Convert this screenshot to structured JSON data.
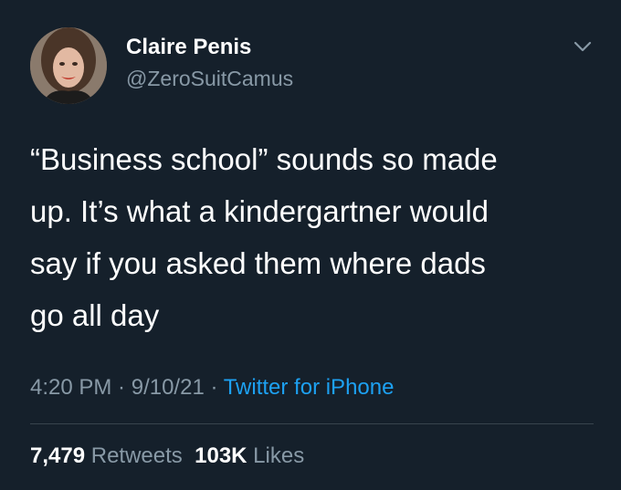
{
  "author": {
    "name": "Claire Penis",
    "handle": "@ZeroSuitCamus"
  },
  "tweet": {
    "lines": [
      "“Business school” sounds so made",
      "up. It’s what a kindergartner would",
      "say if you asked them where dads",
      "go all day"
    ],
    "time": "4:20 PM",
    "date": "9/10/21",
    "separator": " · ",
    "source": "Twitter for iPhone"
  },
  "stats": {
    "retweets_count": "7,479",
    "retweets_label": "Retweets",
    "likes_count": "103K",
    "likes_label": "Likes"
  },
  "icons": {
    "menu": "chevron-down-icon",
    "avatar": "avatar"
  },
  "colors": {
    "background": "#15202b",
    "text": "#ffffff",
    "secondary": "#8899a6",
    "link": "#1da1f2",
    "divider": "#38444d"
  }
}
